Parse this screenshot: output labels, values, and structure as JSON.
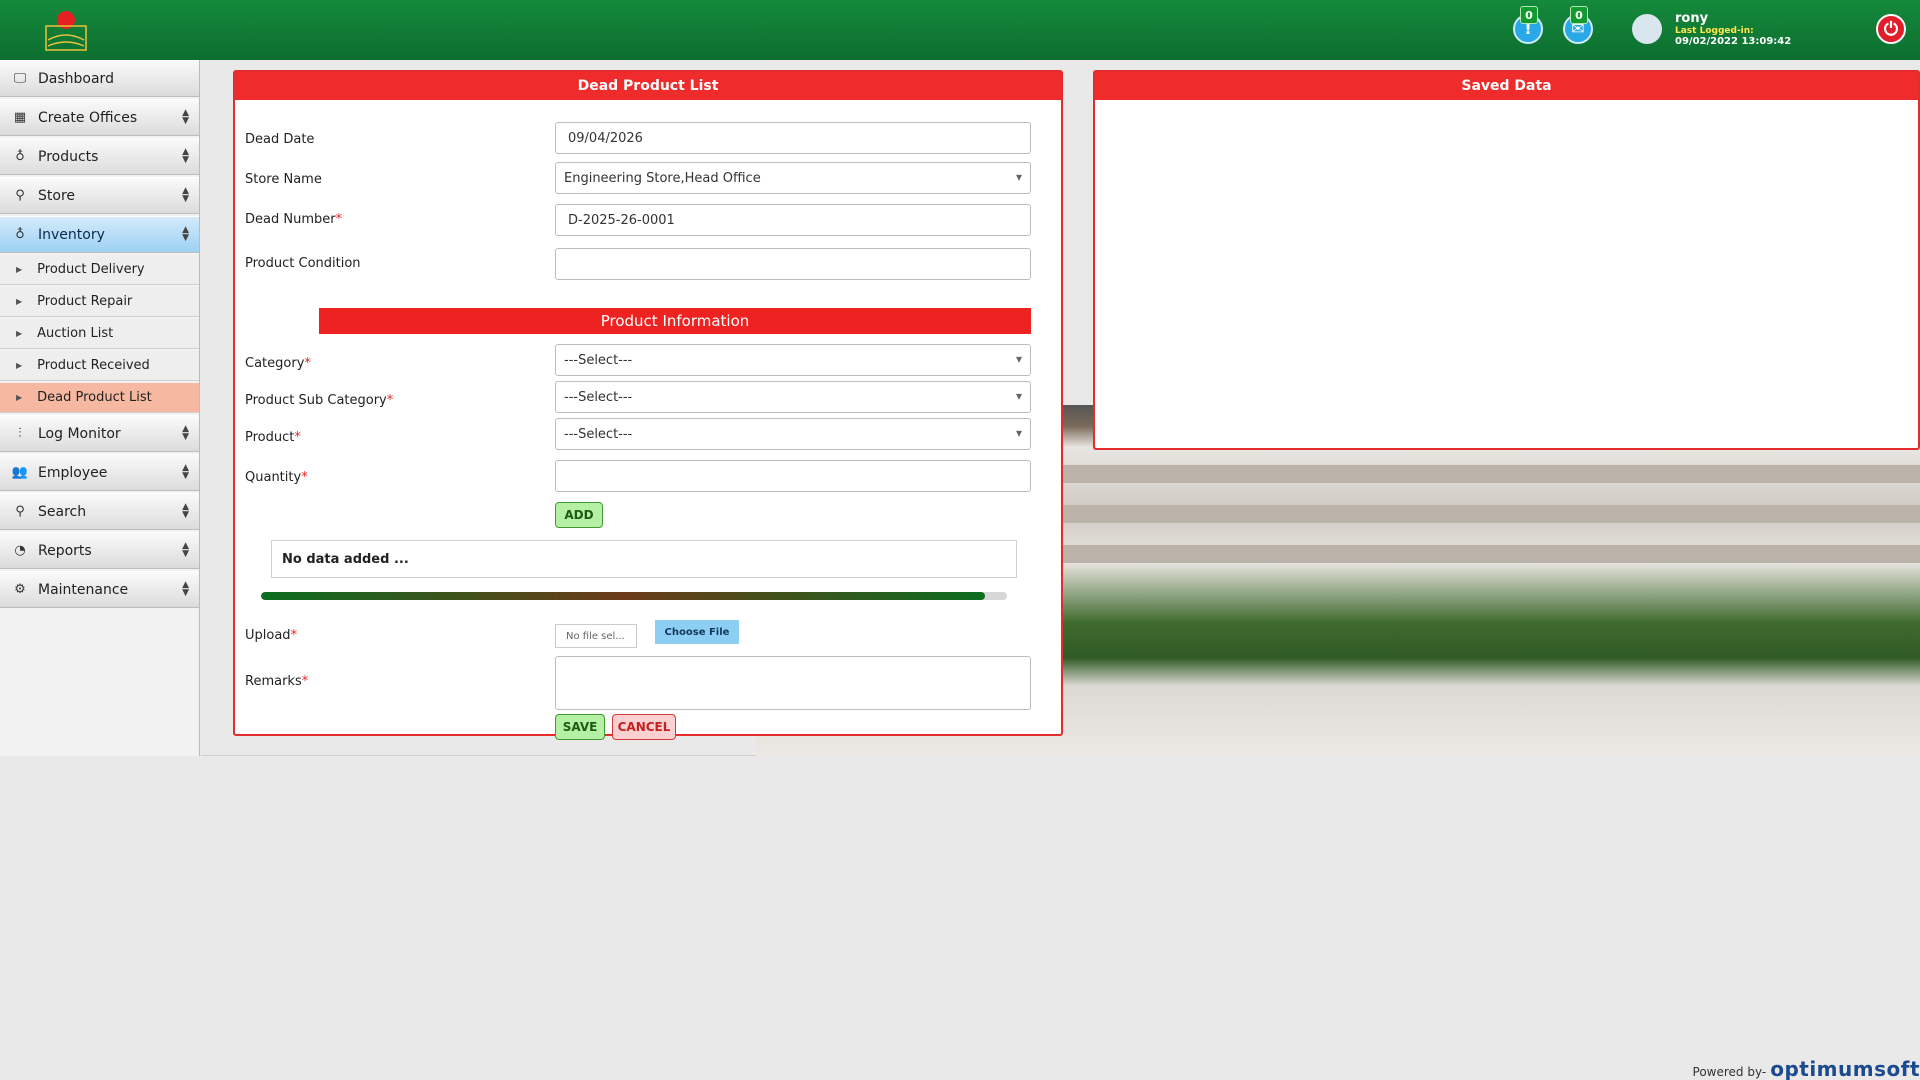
{
  "header": {
    "user_name": "rony",
    "last_logged_label": "Last Logged-in:",
    "last_logged_time": "09/02/2022 13:09:42",
    "alerts_count": "0",
    "messages_count": "0"
  },
  "sidebar": {
    "items": [
      {
        "label": "Dashboard",
        "icon": "monitor-icon"
      },
      {
        "label": "Create Offices",
        "icon": "building-icon"
      },
      {
        "label": "Products",
        "icon": "droplet-icon"
      },
      {
        "label": "Store",
        "icon": "search-icon"
      },
      {
        "label": "Inventory",
        "icon": "droplet-icon"
      },
      {
        "label": "Log Monitor",
        "icon": "sliders-icon"
      },
      {
        "label": "Employee",
        "icon": "users-icon"
      },
      {
        "label": "Search",
        "icon": "search-icon"
      },
      {
        "label": "Reports",
        "icon": "pie-chart-icon"
      },
      {
        "label": "Maintenance",
        "icon": "gear-icon"
      }
    ],
    "inventory_sub": [
      "Product Delivery",
      "Product Repair",
      "Auction List",
      "Product Received",
      "Dead Product List"
    ]
  },
  "form_panel": {
    "title": "Dead Product List",
    "dead_date_label": "Dead Date",
    "dead_date_value": "09/04/2026",
    "store_name_label": "Store Name",
    "store_name_value": "Engineering Store,Head Office",
    "dead_number_label": "Dead Number",
    "dead_number_value": "D-2025-26-0001",
    "product_condition_label": "Product Condition",
    "product_info_title": "Product Information",
    "category_label": "Category",
    "category_value": "---Select---",
    "sub_category_label": "Product Sub Category",
    "sub_category_value": "---Select---",
    "product_label": "Product",
    "product_value": "---Select---",
    "quantity_label": "Quantity",
    "add_button": "ADD",
    "no_data_text": "No data added ...",
    "upload_label": "Upload",
    "no_file_text": "No file sel...",
    "choose_file_button": "Choose File",
    "remarks_label": "Remarks",
    "save_button": "SAVE",
    "cancel_button": "CANCEL",
    "required_mark": "*"
  },
  "saved_panel": {
    "title": "Saved Data"
  },
  "footer": {
    "powered_by": "Powered by-",
    "brand": "optimumsoft"
  }
}
